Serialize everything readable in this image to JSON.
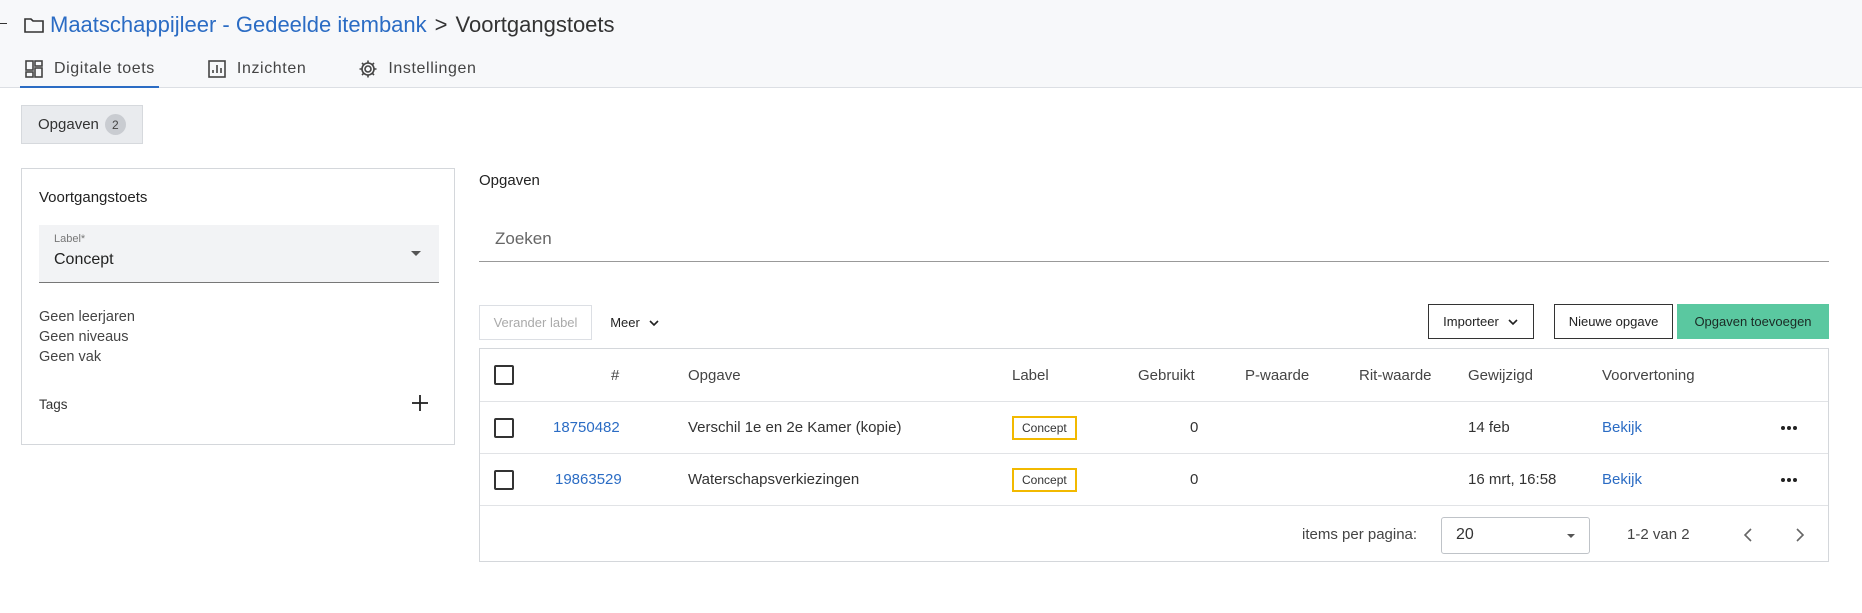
{
  "breadcrumb": {
    "parent": "Maatschappijleer - Gedeelde itembank",
    "separator": ">",
    "current": "Voortgangstoets"
  },
  "tabs": [
    {
      "label": "Digitale toets",
      "icon": "dashboard-icon",
      "active": true
    },
    {
      "label": "Inzichten",
      "icon": "chart-icon",
      "active": false
    },
    {
      "label": "Instellingen",
      "icon": "gear-icon",
      "active": false
    }
  ],
  "chip": {
    "label": "Opgaven",
    "count": "2"
  },
  "sidebar": {
    "title": "Voortgangstoets",
    "label_field": {
      "label": "Label*",
      "value": "Concept"
    },
    "lines": [
      "Geen leerjaren",
      "Geen niveaus",
      "Geen vak"
    ],
    "tags_label": "Tags"
  },
  "main": {
    "title": "Opgaven",
    "search_placeholder": "Zoeken"
  },
  "toolbar": {
    "change_label": "Verander label",
    "more": "Meer",
    "import": "Importeer",
    "new_item": "Nieuwe opgave",
    "add_items": "Opgaven toevoegen"
  },
  "table": {
    "columns": [
      "#",
      "Opgave",
      "Label",
      "Gebruikt",
      "P-waarde",
      "Rit-waarde",
      "Gewijzigd",
      "Voorvertoning"
    ],
    "rows": [
      {
        "id": "18750482",
        "title": "Verschil 1e en 2e Kamer (kopie)",
        "label": "Concept",
        "used": "0",
        "p": "",
        "rit": "",
        "modified": "14 feb",
        "preview": "Bekijk"
      },
      {
        "id": "19863529",
        "title": "Waterschapsverkiezingen",
        "label": "Concept",
        "used": "0",
        "p": "",
        "rit": "",
        "modified": "16 mrt, 16:58",
        "preview": "Bekijk"
      }
    ]
  },
  "pager": {
    "label": "items per pagina:",
    "per_page": "20",
    "range": "1-2 van 2"
  },
  "colors": {
    "accent": "#2b6cc4",
    "primary_button": "#5ac8a0",
    "badge_border": "#f2b900"
  }
}
